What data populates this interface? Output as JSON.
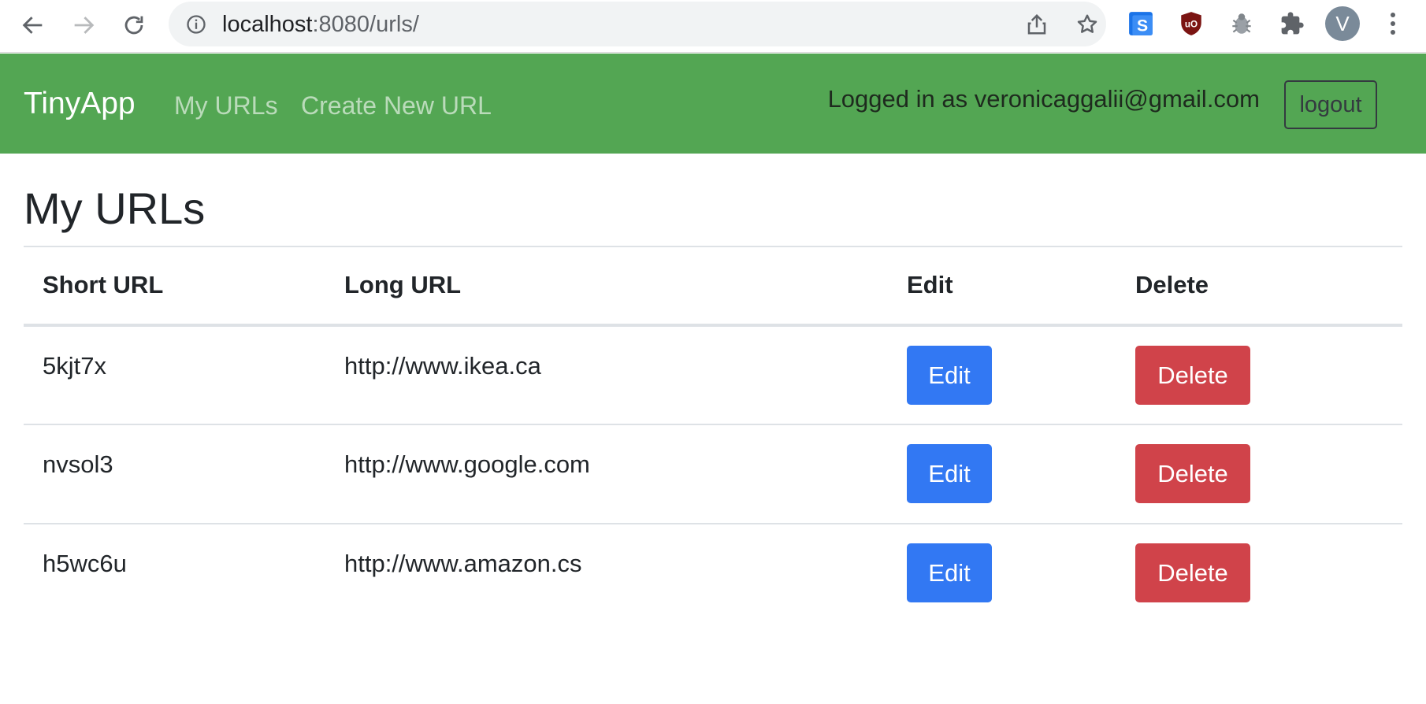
{
  "browser": {
    "url_host": "localhost",
    "url_rest": ":8080/urls/",
    "avatar_letter": "V",
    "extensions": [
      "s-extension-icon",
      "ublock-icon",
      "bug-extension-icon",
      "puzzle-icon"
    ]
  },
  "navbar": {
    "brand": "TinyApp",
    "links": [
      "My URLs",
      "Create New URL"
    ],
    "logged_in_text": "Logged in as veronicaggalii@gmail.com",
    "logout_label": "logout",
    "background": "#53a653"
  },
  "main": {
    "title": "My URLs",
    "table": {
      "headers": [
        "Short URL",
        "Long URL",
        "Edit",
        "Delete"
      ],
      "rows": [
        {
          "short": "5kjt7x",
          "long": "http://www.ikea.ca",
          "edit": "Edit",
          "delete": "Delete"
        },
        {
          "short": "nvsol3",
          "long": "http://www.google.com",
          "edit": "Edit",
          "delete": "Delete"
        },
        {
          "short": "h5wc6u",
          "long": "http://www.amazon.cs",
          "edit": "Edit",
          "delete": "Delete"
        }
      ]
    },
    "colors": {
      "edit_button": "#3278f3",
      "delete_button": "#d0434a"
    }
  }
}
